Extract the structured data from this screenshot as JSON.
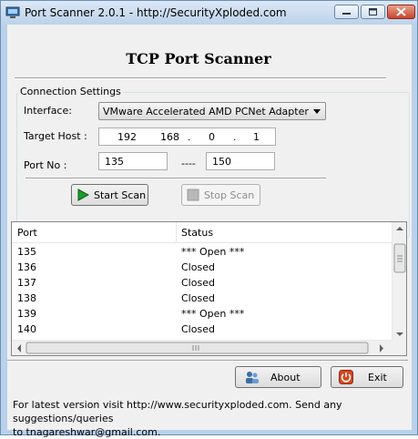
{
  "window": {
    "title": "Port Scanner 2.0.1 - http://SecurityXploded.com",
    "icon": "app-monitor-icon"
  },
  "header": {
    "title": "TCP Port Scanner"
  },
  "connection": {
    "group_label": "Connection Settings",
    "interface_label": "Interface:",
    "interface_value": "VMware Accelerated AMD PCNet Adapter",
    "target_label": "Target Host :",
    "ip": [
      "192",
      "168",
      "0",
      "1"
    ],
    "port_label": "Port No :",
    "port_start": "135",
    "port_sep": "----",
    "port_end": "150"
  },
  "actions": {
    "start_label": "Start Scan",
    "stop_label": "Stop Scan"
  },
  "results": {
    "columns": [
      "Port",
      "Status"
    ],
    "rows": [
      {
        "port": "135",
        "status": "*** Open ***"
      },
      {
        "port": "136",
        "status": "Closed"
      },
      {
        "port": "137",
        "status": "Closed"
      },
      {
        "port": "138",
        "status": "Closed"
      },
      {
        "port": "139",
        "status": "*** Open ***"
      },
      {
        "port": "140",
        "status": "Closed"
      }
    ]
  },
  "bottom": {
    "about_label": "About",
    "exit_label": "Exit"
  },
  "footer": {
    "line1": "For latest version visit http://www.securityxploded.com. Send any suggestions/queries",
    "line2": "to tnagareshwar@gmail.com."
  },
  "colors": {
    "start_icon": "#1a9b2a",
    "exit_icon": "#d9461e",
    "title_close": "#c7452a"
  }
}
